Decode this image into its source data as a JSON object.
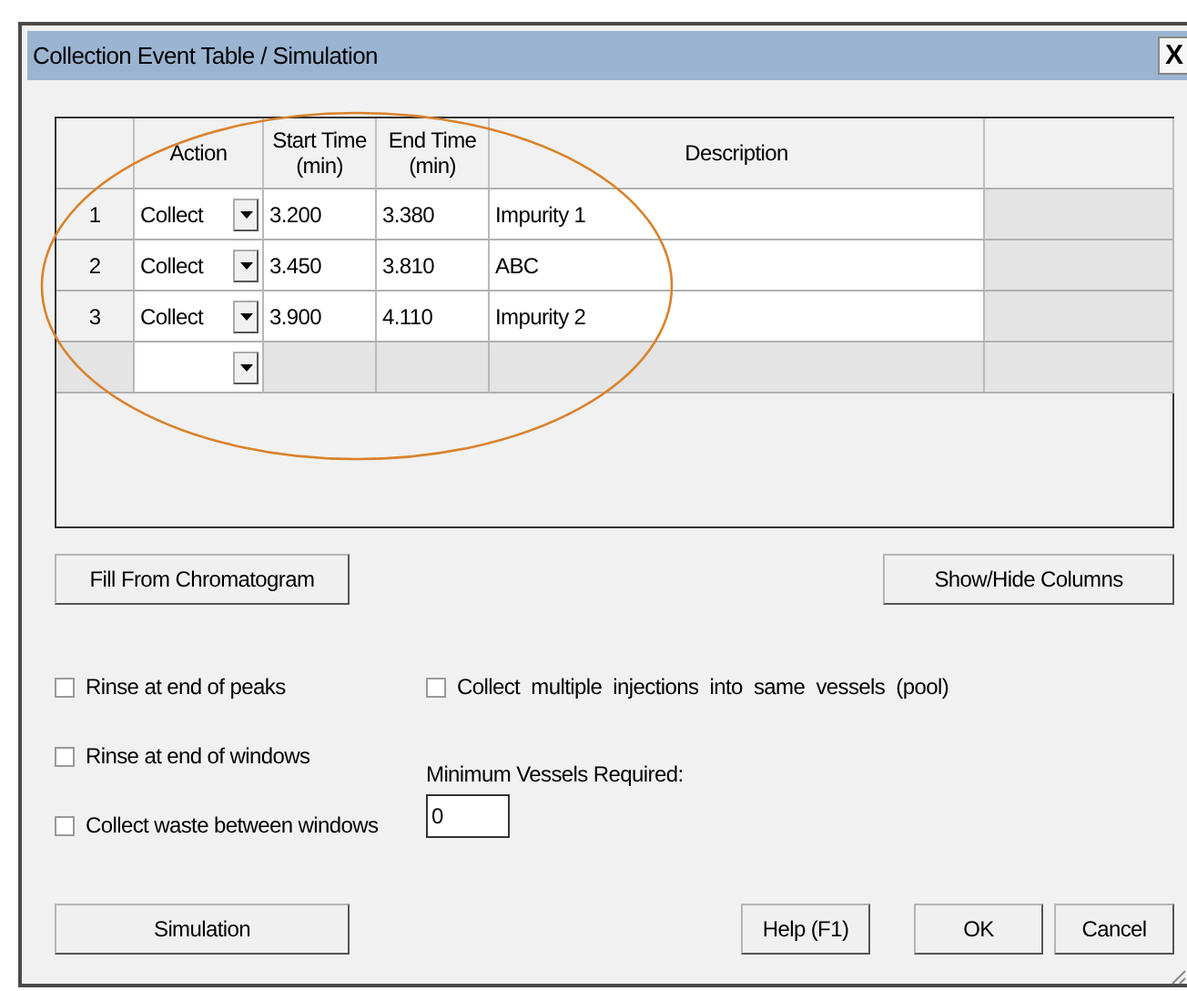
{
  "window": {
    "title": "Collection Event Table / Simulation",
    "close": "X"
  },
  "table": {
    "columns": [
      {
        "label": "Action"
      },
      {
        "label": "Start Time",
        "unit": "(min)"
      },
      {
        "label": "End Time",
        "unit": "(min)"
      },
      {
        "label": "Description"
      }
    ],
    "rows": [
      {
        "kind": "entry",
        "number": "1",
        "action": "Collect",
        "start": "3.200",
        "end": "3.380",
        "description": "Impurity 1"
      },
      {
        "kind": "entry",
        "number": "2",
        "action": "Collect",
        "start": "3.450",
        "end": "3.810",
        "description": "ABC"
      },
      {
        "kind": "entry",
        "number": "3",
        "action": "Collect",
        "start": "3.900",
        "end": "4.110",
        "description": "Impurity 2"
      },
      {
        "kind": "new"
      }
    ]
  },
  "table_buttons": [
    "Fill From Chromatogram",
    "Show/Hide Columns"
  ],
  "left_options": [
    {
      "label": "Rinse at end of peaks",
      "checked": false
    },
    {
      "label": "Rinse at end of windows",
      "checked": false
    },
    {
      "label": "Collect waste between windows",
      "checked": false
    }
  ],
  "right_option": {
    "label": "Collect  multiple  injections  into  same  vessels  (pool)",
    "checked": false
  },
  "minimum_vessels": {
    "label": "Minimum Vessels Required:",
    "value": "0"
  },
  "footer_buttons": [
    {
      "kind": "simulation",
      "label": "Simulation"
    },
    {
      "kind": "help",
      "label": "Help (F1)"
    },
    {
      "kind": "ok",
      "label": "OK"
    },
    {
      "kind": "cancel",
      "label": "Cancel"
    }
  ]
}
